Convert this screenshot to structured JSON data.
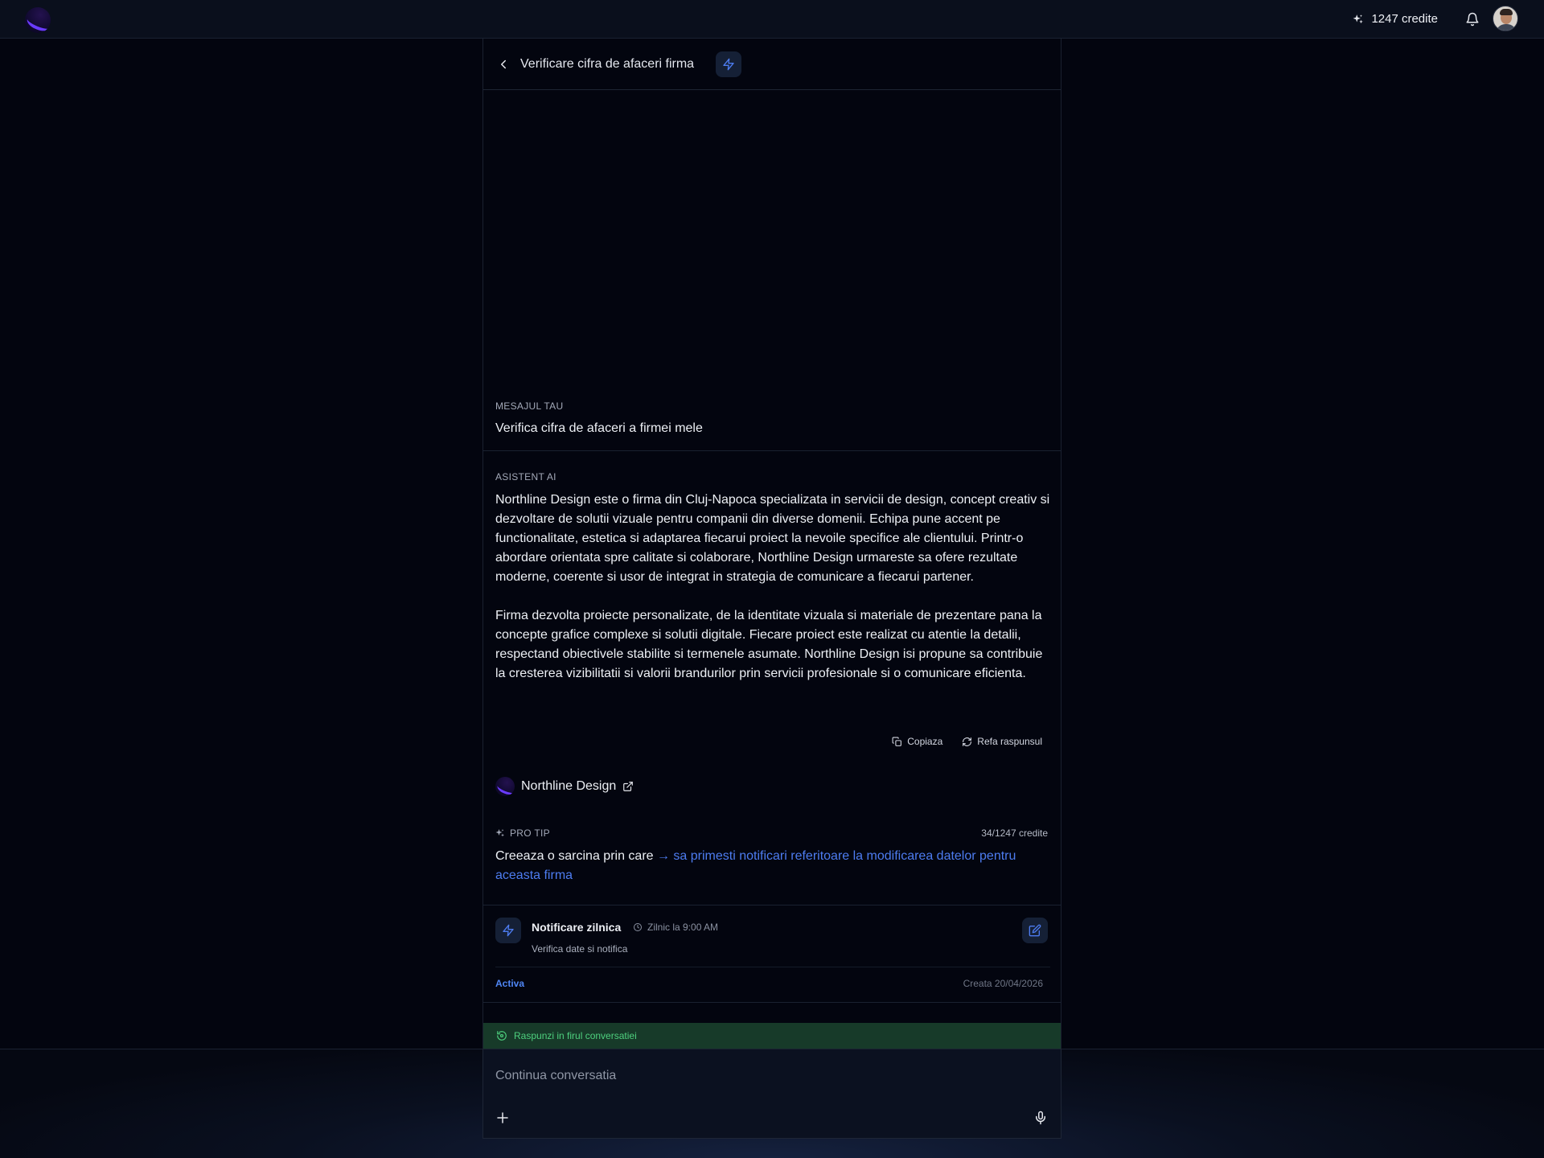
{
  "topbar": {
    "credits_label": "1247 credite"
  },
  "header": {
    "title": "Verificare cifra de afaceri firma"
  },
  "messages": {
    "user_label": "MESAJUL TAU",
    "user_text": "Verifica cifra de afaceri a firmei mele",
    "ai_label": "ASISTENT AI",
    "ai_paragraph_1": "Northline Design este o firma din Cluj-Napoca specializata in servicii de design, concept creativ si dezvoltare de solutii vizuale pentru companii din diverse domenii. Echipa pune accent pe functionalitate, estetica si adaptarea fiecarui proiect la nevoile specifice ale clientului. Printr-o abordare orientata spre calitate si colaborare, Northline Design urmareste sa ofere rezultate moderne, coerente si usor de integrat in strategia de comunicare a fiecarui partener.",
    "ai_paragraph_2": "Firma dezvolta proiecte personalizate, de la identitate vizuala si materiale de prezentare pana la concepte grafice complexe si solutii digitale. Fiecare proiect este realizat cu atentie la detalii, respectand obiectivele stabilite si termenele asumate. Northline Design isi propune sa contribuie la cresterea vizibilitatii si valorii brandurilor prin servicii profesionale si o comunicare eficienta."
  },
  "actions": {
    "copy_label": "Copiaza",
    "redo_label": "Refa raspunsul"
  },
  "source": {
    "name": "Northline Design"
  },
  "protip": {
    "label": "PRO TIP",
    "credits": "34/1247 credite",
    "text_prefix": "Creeaza o sarcina prin care ",
    "link_text": "→ sa primesti notificari referitoare la modificarea datelor pentru aceasta firma"
  },
  "task": {
    "title": "Notificare zilnica",
    "schedule": "Zilnic la 9:00 AM",
    "description": "Verifica date si notifica",
    "status": "Activa",
    "created": "Creata 20/04/2026"
  },
  "thread": {
    "label": "Raspunzi in firul conversatiei"
  },
  "composer": {
    "placeholder": "Continua conversatia"
  },
  "colors": {
    "accent": "#4d7cf0",
    "thread_bg": "#173a29",
    "thread_text": "#4ed07e"
  }
}
